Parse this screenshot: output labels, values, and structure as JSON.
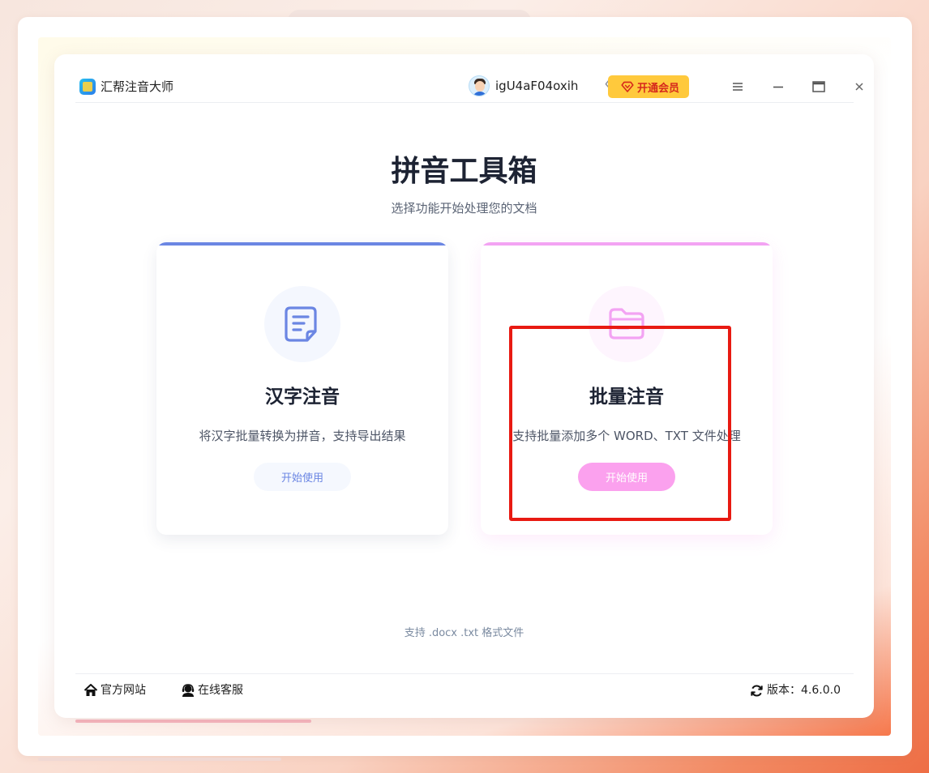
{
  "app": {
    "title": "汇帮注音大师",
    "username": "igU4aF04oxih",
    "vip_label": "开通会员"
  },
  "window_controls": {
    "menu": "≡",
    "minimize": "—",
    "maximize": "▭",
    "close": "×"
  },
  "main": {
    "title": "拼音工具箱",
    "subtitle": "选择功能开始处理您的文档",
    "cards": [
      {
        "title": "汉字注音",
        "description": "将汉字批量转换为拼音，支持导出结果",
        "button": "开始使用",
        "icon": "document-icon",
        "accent": "#6b86e3"
      },
      {
        "title": "批量注音",
        "description": "支持批量添加多个 WORD、TXT 文件处理",
        "button": "开始使用",
        "icon": "folder-icon",
        "accent": "#f3a3f3"
      }
    ],
    "support_note": "支持 .docx .txt 格式文件"
  },
  "footer": {
    "official_site": "官方网站",
    "online_service": "在线客服",
    "version_label": "版本：4.6.0.0"
  },
  "colors": {
    "vip_bg": "#ffc93c",
    "vip_text": "#d6281c",
    "highlight": "#e81a12"
  }
}
